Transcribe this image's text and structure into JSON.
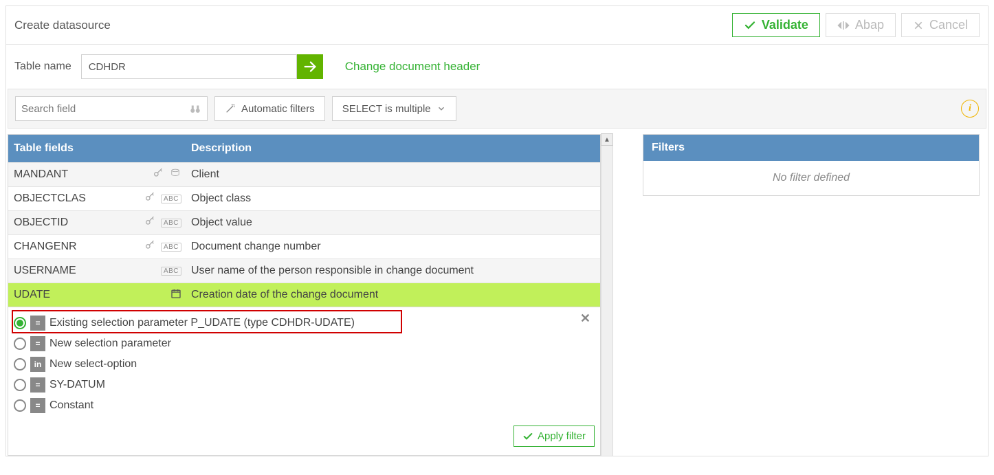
{
  "header": {
    "title": "Create datasource",
    "buttons": {
      "validate": "Validate",
      "abap": "Abap",
      "cancel": "Cancel"
    }
  },
  "tableName": {
    "label": "Table name",
    "value": "CDHDR",
    "description": "Change document header"
  },
  "toolbar": {
    "searchPlaceholder": "Search field",
    "autoFilters": "Automatic filters",
    "selectMode": "SELECT is multiple"
  },
  "grid": {
    "columns": {
      "fields": "Table fields",
      "desc": "Description"
    },
    "rows": [
      {
        "name": "MANDANT",
        "desc": "Client",
        "key": true,
        "type": "db",
        "alt": true,
        "selected": false
      },
      {
        "name": "OBJECTCLAS",
        "desc": "Object class",
        "key": true,
        "type": "abc",
        "alt": false,
        "selected": false
      },
      {
        "name": "OBJECTID",
        "desc": "Object value",
        "key": true,
        "type": "abc",
        "alt": true,
        "selected": false
      },
      {
        "name": "CHANGENR",
        "desc": "Document change number",
        "key": true,
        "type": "abc",
        "alt": false,
        "selected": false
      },
      {
        "name": "USERNAME",
        "desc": "User name of the person responsible in change document",
        "key": false,
        "type": "abc",
        "alt": true,
        "selected": false
      },
      {
        "name": "UDATE",
        "desc": "Creation date of the change document",
        "key": false,
        "type": "date",
        "alt": false,
        "selected": true
      }
    ]
  },
  "options": {
    "items": [
      {
        "label": "Existing selection parameter P_UDATE (type CDHDR-UDATE)",
        "op": "=",
        "checked": true
      },
      {
        "label": "New selection parameter",
        "op": "=",
        "checked": false
      },
      {
        "label": "New select-option",
        "op": "in",
        "checked": false
      },
      {
        "label": "SY-DATUM",
        "op": "=",
        "checked": false
      },
      {
        "label": "Constant",
        "op": "=",
        "checked": false
      }
    ],
    "apply": "Apply filter"
  },
  "filters": {
    "header": "Filters",
    "empty": "No filter defined"
  }
}
